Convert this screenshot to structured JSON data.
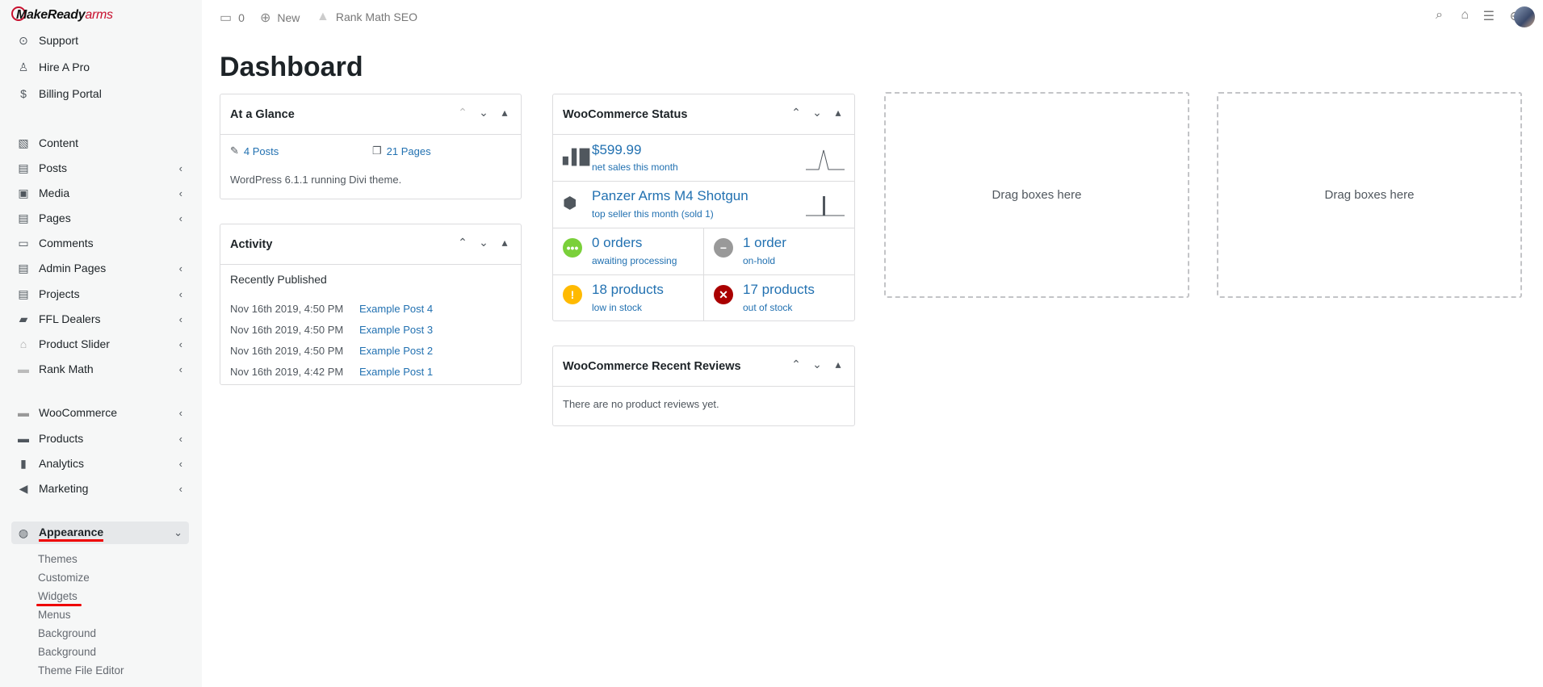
{
  "logo": {
    "brand": "MakeReady",
    "brand_accent": "arms"
  },
  "sidebar": {
    "items": [
      {
        "label": "Support",
        "icon": "support-icon"
      },
      {
        "label": "Hire A Pro",
        "icon": "person-icon"
      },
      {
        "label": "Billing Portal",
        "icon": "dollar-icon"
      },
      {
        "label": "Content",
        "icon": "image-icon"
      },
      {
        "label": "Posts",
        "icon": "post-icon"
      },
      {
        "label": "Media",
        "icon": "media-icon"
      },
      {
        "label": "Pages",
        "icon": "page-icon"
      },
      {
        "label": "Comments",
        "icon": "comment-icon"
      },
      {
        "label": "Admin Pages",
        "icon": "page-icon"
      },
      {
        "label": "Projects",
        "icon": "project-icon"
      },
      {
        "label": "FFL Dealers",
        "icon": "truck-icon"
      },
      {
        "label": "Product Slider",
        "icon": "cart-icon"
      },
      {
        "label": "Rank Math",
        "icon": "rankmath-icon"
      },
      {
        "label": "WooCommerce",
        "icon": "woo-icon"
      },
      {
        "label": "Products",
        "icon": "box-icon"
      },
      {
        "label": "Analytics",
        "icon": "bar-chart-icon"
      },
      {
        "label": "Marketing",
        "icon": "megaphone-icon"
      },
      {
        "label": "Appearance",
        "icon": "palette-icon"
      }
    ],
    "submenu": [
      "Themes",
      "Customize",
      "Widgets",
      "Menus",
      "Background",
      "Background",
      "Theme File Editor"
    ]
  },
  "topbar": {
    "comments_count": "0",
    "new_label": "New",
    "seo_label": "Rank Math SEO"
  },
  "page": {
    "title": "Dashboard"
  },
  "glance": {
    "title": "At a Glance",
    "posts": "4 Posts",
    "pages": "21 Pages",
    "footer": "WordPress 6.1.1 running Divi theme."
  },
  "activity": {
    "title": "Activity",
    "subtitle": "Recently Published",
    "rows": [
      {
        "date": "Nov 16th 2019, 4:50 PM",
        "post": "Example Post 4"
      },
      {
        "date": "Nov 16th 2019, 4:50 PM",
        "post": "Example Post 3"
      },
      {
        "date": "Nov 16th 2019, 4:50 PM",
        "post": "Example Post 2"
      },
      {
        "date": "Nov 16th 2019, 4:42 PM",
        "post": "Example Post 1"
      }
    ]
  },
  "woo": {
    "title": "WooCommerce Status",
    "sales_value": "$599.99",
    "sales_label": "net sales this month",
    "top_seller": "Panzer Arms M4 Shotgun",
    "top_seller_label": "top seller this month (sold 1)",
    "processing_value": "0 orders",
    "processing_label": "awaiting processing",
    "onhold_value": "1 order",
    "onhold_label": "on-hold",
    "lowstock_value": "18 products",
    "lowstock_label": "low in stock",
    "outstock_value": "17 products",
    "outstock_label": "out of stock",
    "colors": {
      "processing": "#7ad03a",
      "onhold": "#999999",
      "lowstock": "#ffba00",
      "outstock": "#aa0000"
    }
  },
  "reviews": {
    "title": "WooCommerce Recent Reviews",
    "empty": "There are no product reviews yet."
  },
  "drop": {
    "label_1": "Drag boxes here",
    "label_2": "Drag boxes here"
  }
}
